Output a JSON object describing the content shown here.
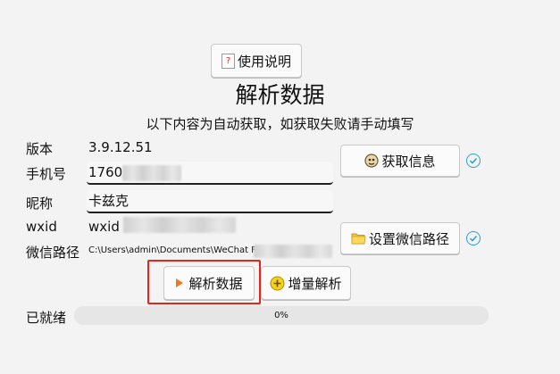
{
  "help_button": {
    "label": "使用说明"
  },
  "title": "解析数据",
  "subtitle": "以下内容为自动获取，如获取失败请手动填写",
  "fields": {
    "version": {
      "label": "版本",
      "value": "3.9.12.51"
    },
    "phone": {
      "label": "手机号",
      "value": "1760"
    },
    "nickname": {
      "label": "昵称",
      "value": "卡兹克"
    },
    "wxid": {
      "label": "wxid",
      "value": "wxid"
    },
    "wechat_path": {
      "label": "微信路径",
      "value": "C:\\Users\\admin\\Documents\\WeChat Files\\"
    }
  },
  "buttons": {
    "get_info": "获取信息",
    "set_path": "设置微信路径",
    "parse": "解析数据",
    "incremental": "增量解析"
  },
  "status": {
    "label": "已就绪",
    "progress_percent": 0,
    "progress_text": "0%"
  },
  "colors": {
    "accent": "#2aa0c8",
    "highlight": "#e0271d",
    "play": "#f07a1b"
  }
}
